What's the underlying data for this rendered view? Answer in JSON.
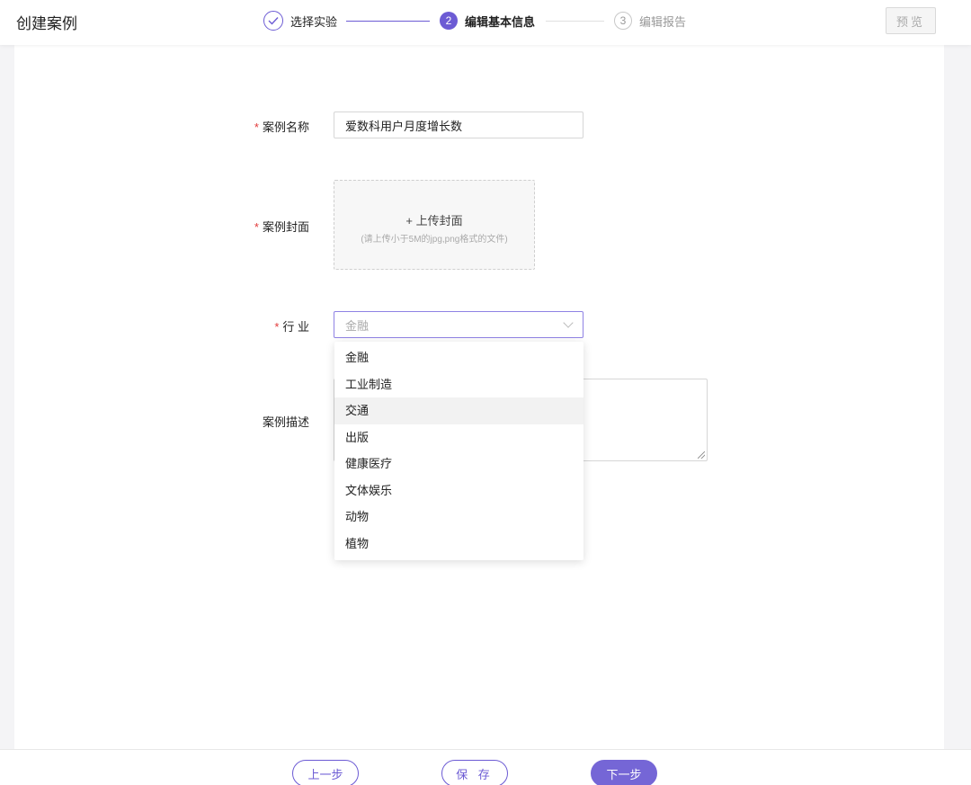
{
  "header": {
    "title": "创建案例",
    "steps": [
      {
        "index": "✓",
        "label": "选择实验",
        "state": "done"
      },
      {
        "index": "2",
        "label": "编辑基本信息",
        "state": "active"
      },
      {
        "index": "3",
        "label": "编辑报告",
        "state": "todo"
      }
    ],
    "preview_label": "预览"
  },
  "form": {
    "name_label": "案例名称",
    "name_value": "爱数科用户月度增长数",
    "cover_label": "案例封面",
    "cover_upload_title": "+ 上传封面",
    "cover_upload_hint": "(请上传小于5M的jpg,png格式的文件)",
    "industry_label": "行 业",
    "industry_placeholder": "金融",
    "description_label": "案例描述",
    "required_mark": "*"
  },
  "industry_dropdown": {
    "options": [
      "金融",
      "工业制造",
      "交通",
      "出版",
      "健康医疗",
      "文体娱乐",
      "动物",
      "植物"
    ],
    "hovered": "交通"
  },
  "footer": {
    "prev_label": "上一步",
    "save_label": "保 存",
    "next_label": "下一步"
  },
  "colors": {
    "accent": "#6c5bd4",
    "required": "#e23a3a"
  }
}
